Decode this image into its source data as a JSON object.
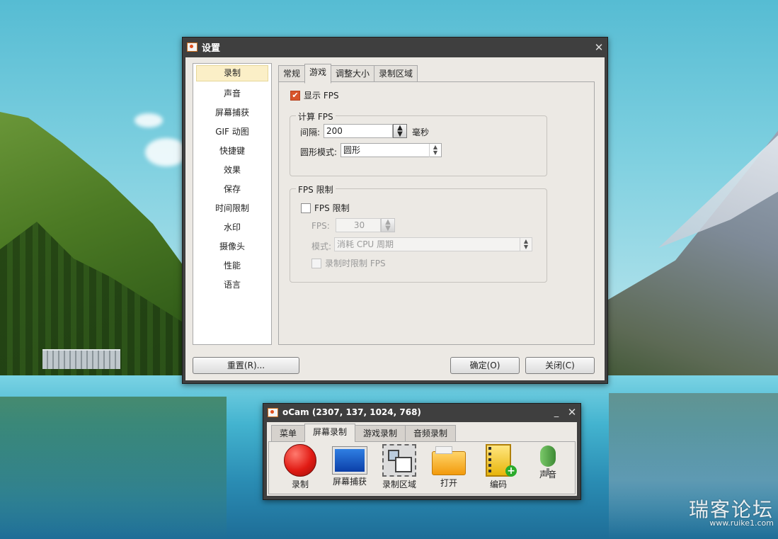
{
  "settings": {
    "title": "设置",
    "close_glyph": "✕",
    "categories": [
      "录制",
      "声音",
      "屏幕捕获",
      "GIF 动图",
      "快捷键",
      "效果",
      "保存",
      "时间限制",
      "水印",
      "摄像头",
      "性能",
      "语言"
    ],
    "tabs": [
      "常规",
      "游戏",
      "调整大小",
      "录制区域"
    ],
    "active_tab": "游戏",
    "game": {
      "show_fps_label": "显示 FPS",
      "show_fps_checked": true,
      "calc_group_title": "计算 FPS",
      "interval_label": "间隔:",
      "interval_value": "200",
      "interval_unit": "毫秒",
      "shape_mode_label": "圆形模式:",
      "shape_mode_value": "圆形",
      "limit_group_title": "FPS 限制",
      "fps_limit_label": "FPS 限制",
      "fps_limit_checked": false,
      "fps_label": "FPS:",
      "fps_value": "30",
      "mode_label": "模式:",
      "mode_value": "消耗 CPU 周期",
      "record_limit_label": "录制时限制 FPS",
      "record_limit_checked": false
    },
    "buttons": {
      "reset": "重置(R)...",
      "ok": "确定(O)",
      "close": "关闭(C)"
    }
  },
  "ocam": {
    "title": "oCam (2307, 137, 1024, 768)",
    "minimize_glyph": "_",
    "close_glyph": "✕",
    "tabs": [
      "菜单",
      "屏幕录制",
      "游戏录制",
      "音频录制"
    ],
    "active_tab": "屏幕录制",
    "tools": [
      {
        "label": "录制",
        "icon": "record-icon"
      },
      {
        "label": "屏幕捕获",
        "icon": "monitor-icon"
      },
      {
        "label": "录制区域",
        "icon": "capture-area-icon"
      },
      {
        "label": "打开",
        "icon": "folder-icon"
      },
      {
        "label": "编码",
        "icon": "film-add-icon"
      },
      {
        "label": "声音",
        "icon": "microphone-icon"
      }
    ]
  },
  "watermark": {
    "title": "瑞客论坛",
    "url": "www.ruike1.com"
  },
  "colors": {
    "checkbox_on": "#d8542a",
    "titlebar": "#3f3f3f",
    "dialog_bg": "#ece9e4"
  }
}
